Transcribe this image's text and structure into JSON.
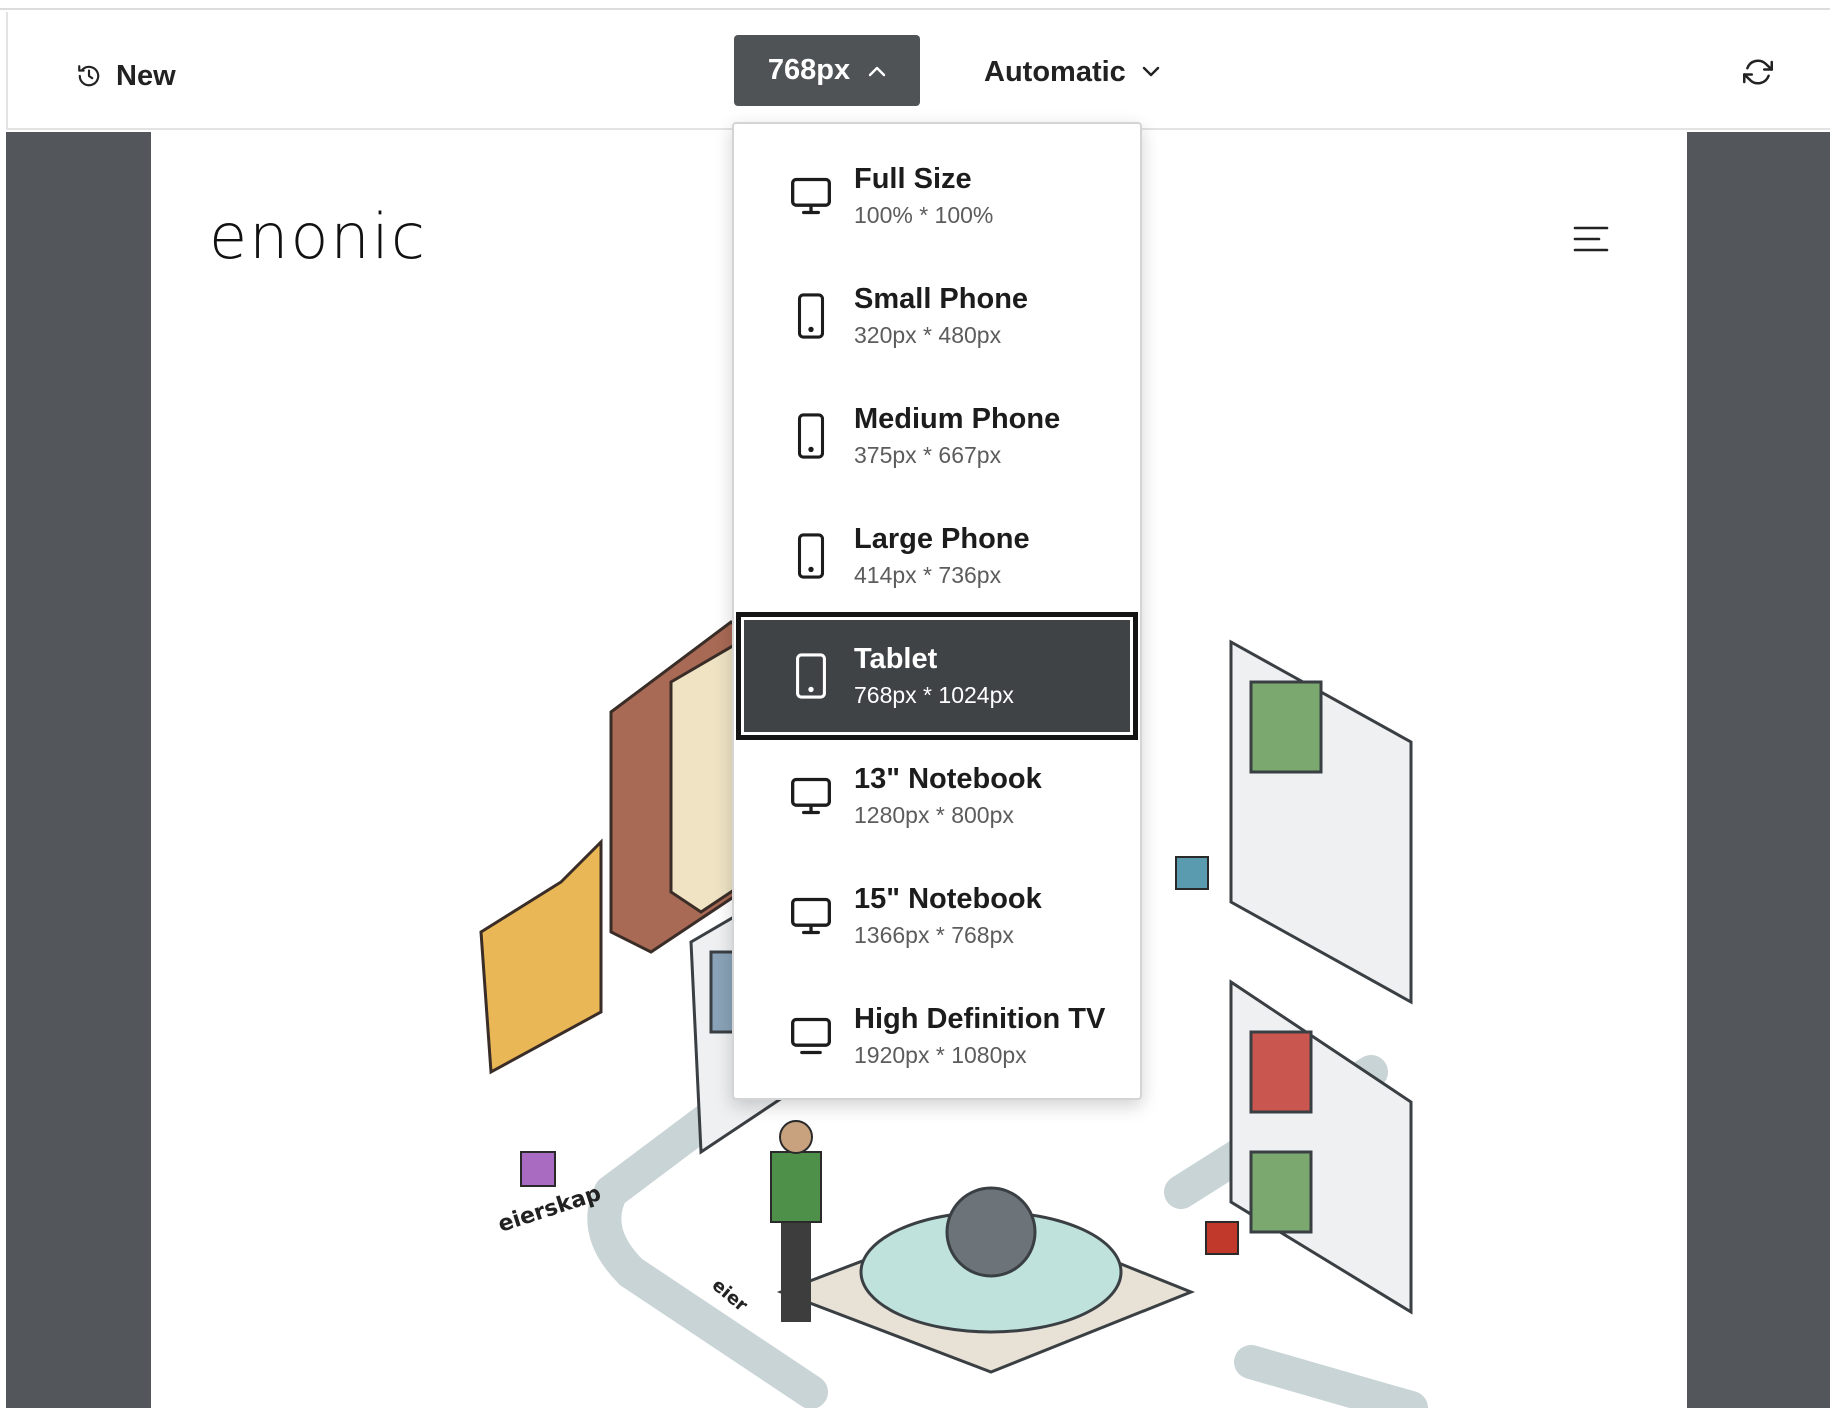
{
  "toolbar": {
    "new_label": "New",
    "size_label": "768px",
    "mode_label": "Automatic",
    "icons": {
      "history": "history-icon",
      "chevron_up": "chevron-up-icon",
      "chevron_down": "chevron-down-icon",
      "refresh": "refresh-icon"
    }
  },
  "preview": {
    "logo_text": "enonic",
    "menu_icon": "hamburger-menu-icon",
    "illustration_text": [
      "eierskap",
      "eier"
    ]
  },
  "dropdown": {
    "selected_index": 4,
    "items": [
      {
        "name": "Full Size",
        "dim": "100% * 100%",
        "icon": "monitor-icon"
      },
      {
        "name": "Small Phone",
        "dim": "320px * 480px",
        "icon": "phone-icon"
      },
      {
        "name": "Medium Phone",
        "dim": "375px * 667px",
        "icon": "phone-icon"
      },
      {
        "name": "Large Phone",
        "dim": "414px * 736px",
        "icon": "phone-icon"
      },
      {
        "name": "Tablet",
        "dim": "768px * 1024px",
        "icon": "tablet-icon"
      },
      {
        "name": "13\" Notebook",
        "dim": "1280px * 800px",
        "icon": "monitor-icon"
      },
      {
        "name": "15\" Notebook",
        "dim": "1366px * 768px",
        "icon": "monitor-icon"
      },
      {
        "name": "High Definition TV",
        "dim": "1920px * 1080px",
        "icon": "tv-icon"
      }
    ]
  },
  "colors": {
    "size_button_bg": "#4f5356",
    "preview_surround": "#53575c",
    "selected_item_bg": "#3f4346"
  }
}
